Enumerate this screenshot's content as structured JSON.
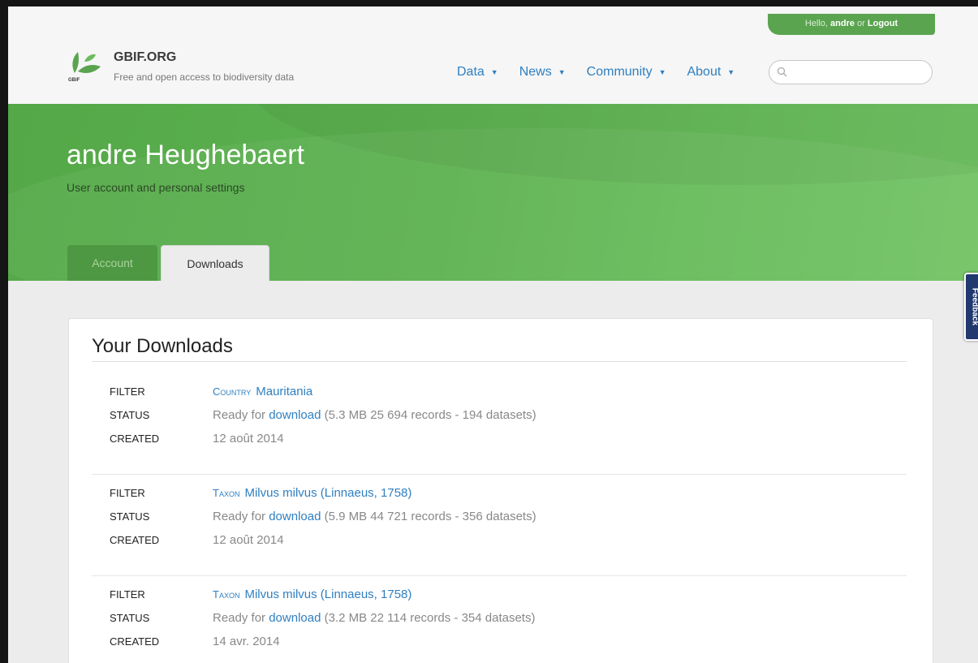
{
  "header": {
    "greeting_prefix": "Hello,",
    "username": "andre",
    "or": "or",
    "logout": "Logout",
    "brand_name": "GBIF.ORG",
    "brand_tagline": "Free and open access to biodiversity data",
    "logo_text": "GBIF",
    "nav": [
      {
        "label": "Data"
      },
      {
        "label": "News"
      },
      {
        "label": "Community"
      },
      {
        "label": "About"
      }
    ],
    "search_placeholder": ""
  },
  "profile": {
    "name": "andre Heughebaert",
    "subtitle": "User account and personal settings",
    "tabs": [
      {
        "label": "Account",
        "active": false
      },
      {
        "label": "Downloads",
        "active": true
      }
    ]
  },
  "feedback": {
    "label": "Feedback"
  },
  "downloads": {
    "title": "Your Downloads",
    "labels": {
      "filter": "FILTER",
      "status": "STATUS",
      "created": "CREATED"
    },
    "status_prefix": "Ready for",
    "download_link": "download",
    "items": [
      {
        "filter_type": "Country",
        "filter_value": "Mauritania",
        "status_detail": "(5.3 MB 25 694 records - 194 datasets)",
        "created": "12 août 2014"
      },
      {
        "filter_type": "Taxon",
        "filter_value": "Milvus milvus (Linnaeus, 1758)",
        "status_detail": "(5.9 MB 44 721 records - 356 datasets)",
        "created": "12 août 2014"
      },
      {
        "filter_type": "Taxon",
        "filter_value": "Milvus milvus (Linnaeus, 1758)",
        "status_detail": "(3.2 MB 22 114 records - 354 datasets)",
        "created": "14 avr. 2014"
      }
    ]
  },
  "colors": {
    "brand_green": "#5aa44f",
    "link_blue": "#2f7fc0",
    "feedback_navy": "#21396f"
  }
}
